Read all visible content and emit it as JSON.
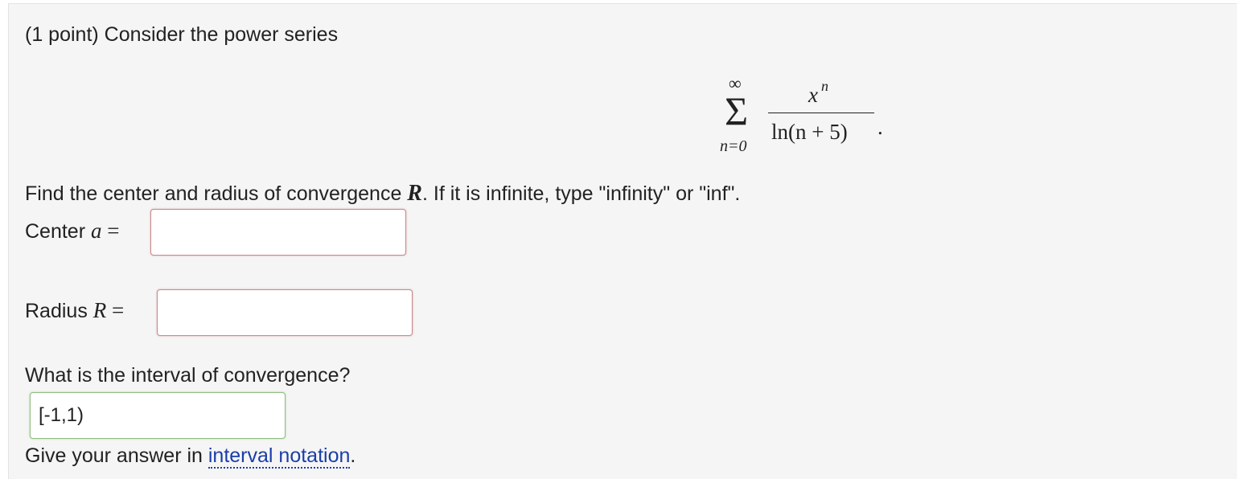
{
  "problem": {
    "intro": "(1 point) Consider the power series",
    "formula": {
      "sum_upper": "∞",
      "sum_symbol": "Σ",
      "sum_lower": "n=0",
      "numerator_base": "x",
      "numerator_exp": "n",
      "denominator": "ln(n + 5)",
      "trailing": "."
    },
    "instruction_prefix": "Find the center and radius of convergence ",
    "instruction_var": "R",
    "instruction_suffix": ". If it is infinite, type \"infinity\" or \"inf\".",
    "center": {
      "label_prefix": "Center ",
      "label_var": "a",
      "label_eq": " =",
      "value": ""
    },
    "radius": {
      "label_prefix": "Radius ",
      "label_var": "R",
      "label_eq": " =",
      "value": ""
    },
    "interval": {
      "question": "What is the interval of convergence?",
      "value": "[-1,1)"
    },
    "hint_prefix": "Give your answer in ",
    "hint_link": "interval notation",
    "hint_suffix": "."
  },
  "colors": {
    "panel_bg": "#f5f5f5",
    "incorrect_border": "#c98a8a",
    "correct_border": "#8fbf7f",
    "link": "#1a3ea8"
  }
}
